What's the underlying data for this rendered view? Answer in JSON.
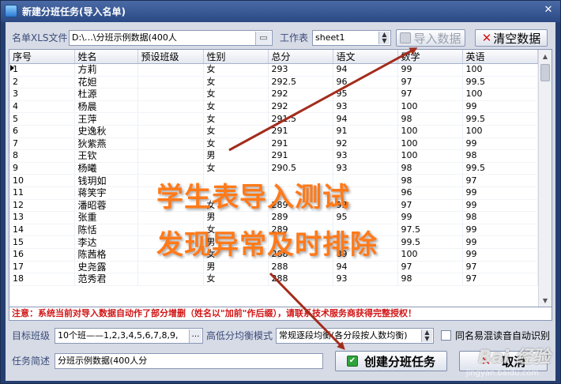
{
  "window": {
    "title": "新建分班任务(导入名单)",
    "close_glyph": "✕"
  },
  "toolbar": {
    "file_label": "名单XLS文件",
    "file_value": "D:\\…\\分班示例数据(400人",
    "sheet_label": "工作表",
    "sheet_value": "sheet1",
    "import_label": "导入数据",
    "clear_label": "清空数据"
  },
  "grid": {
    "headers": [
      "序号",
      "姓名",
      "预设班级",
      "性别",
      "总分",
      "语文",
      "数学",
      "英语"
    ],
    "rows": [
      [
        "1",
        "方莉",
        "",
        "女",
        "293",
        "94",
        "99",
        "100"
      ],
      [
        "2",
        "花妲",
        "",
        "女",
        "292.5",
        "96",
        "97",
        "99.5"
      ],
      [
        "3",
        "杜源",
        "",
        "女",
        "292",
        "95",
        "97",
        "100"
      ],
      [
        "4",
        "杨晨",
        "",
        "女",
        "292",
        "93",
        "100",
        "99"
      ],
      [
        "5",
        "王萍",
        "",
        "女",
        "291.5",
        "94",
        "98",
        "99.5"
      ],
      [
        "6",
        "史逸秋",
        "",
        "女",
        "291",
        "91",
        "100",
        "100"
      ],
      [
        "7",
        "狄紫燕",
        "",
        "女",
        "291",
        "92",
        "100",
        "99"
      ],
      [
        "8",
        "王钦",
        "",
        "男",
        "291",
        "93",
        "100",
        "98"
      ],
      [
        "9",
        "杨曦",
        "",
        "女",
        "290.5",
        "93",
        "98",
        "99.5"
      ],
      [
        "10",
        "钱玥如",
        "",
        "",
        "",
        "",
        "98",
        "97"
      ],
      [
        "11",
        "蒋笑宇",
        "",
        "",
        "",
        "",
        "96",
        "99"
      ],
      [
        "12",
        "潘昭蓉",
        "",
        "女",
        "289",
        "93",
        "97",
        "99"
      ],
      [
        "13",
        "张重",
        "",
        "男",
        "289",
        "95",
        "99",
        "98"
      ],
      [
        "14",
        "陈恬",
        "",
        "女",
        "289",
        "",
        "97.5",
        "99"
      ],
      [
        "15",
        "李达",
        "",
        "男",
        "",
        "",
        "99.5",
        "99"
      ],
      [
        "16",
        "陈茜格",
        "",
        "女",
        "288",
        "89",
        "100",
        "99"
      ],
      [
        "17",
        "史尧露",
        "",
        "男",
        "288",
        "94",
        "97",
        "97"
      ],
      [
        "18",
        "范秀君",
        "",
        "女",
        "288",
        "93",
        "98",
        "97"
      ]
    ]
  },
  "notice": "注意：系统当前对导入数据自动作了部分增删（姓名以\"加前\"作后缀），请联系技术服务商获得完整授权！",
  "settings": {
    "target_label": "目标班级",
    "target_value": "10个班——1,2,3,4,5,6,7,8,9,",
    "dots": "…",
    "balance_label": "高低分均衡模式",
    "balance_value": "常规逐段均衡(各分段按人数均衡)",
    "checkbox_label": "同名易混读音自动识别",
    "desc_label": "任务简述",
    "desc_value": "分班示例数据(400人分"
  },
  "actions": {
    "create_label": "创建分班任务",
    "cancel_label": "取消"
  },
  "annotation": {
    "line1": "学生表导入测试",
    "line2": "发现异常及时排除"
  },
  "watermark": {
    "brand": "Bai 经验",
    "url": "jingyan.baidu.com"
  },
  "colors": {
    "title_bar": "#2b4a86",
    "client_bg": "#d6dbe6",
    "annotation": "#ff7a1a",
    "arrow": "#a32c1c",
    "notice": "#d11616"
  }
}
